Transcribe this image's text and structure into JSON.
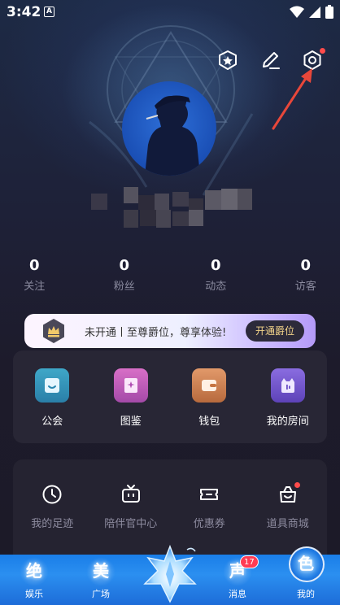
{
  "status_bar": {
    "time": "3:42",
    "notif_icon": "A"
  },
  "header": {
    "icons": [
      "badge-star-icon",
      "edit-pencil-icon",
      "settings-hex-icon"
    ]
  },
  "stats": [
    {
      "value": "0",
      "label": "关注"
    },
    {
      "value": "0",
      "label": "粉丝"
    },
    {
      "value": "0",
      "label": "动态"
    },
    {
      "value": "0",
      "label": "访客"
    }
  ],
  "vip_banner": {
    "text": "未开通丨至尊爵位，尊享体验!",
    "button": "开通爵位"
  },
  "main_grid": [
    {
      "label": "公会",
      "icon": "guild-icon"
    },
    {
      "label": "图鉴",
      "icon": "catalog-icon"
    },
    {
      "label": "钱包",
      "icon": "wallet-icon"
    },
    {
      "label": "我的房间",
      "icon": "my-room-icon"
    }
  ],
  "secondary_grid": [
    {
      "label": "我的足迹",
      "icon": "clock-icon"
    },
    {
      "label": "陪伴官中心",
      "icon": "tv-icon"
    },
    {
      "label": "优惠券",
      "icon": "coupon-icon"
    },
    {
      "label": "道具商城",
      "icon": "shop-icon"
    }
  ],
  "tabbar": {
    "tabs": [
      {
        "glyph": "绝",
        "label": "娱乐"
      },
      {
        "glyph": "美",
        "label": "广场"
      },
      {
        "glyph": "声",
        "label": "消息",
        "badge": "17"
      },
      {
        "glyph": "色",
        "label": "我的"
      }
    ]
  },
  "colors": {
    "accent_red": "#ff4b4b",
    "vip_gold": "#f3d48a",
    "tab_blue": "#1a7ee8"
  }
}
